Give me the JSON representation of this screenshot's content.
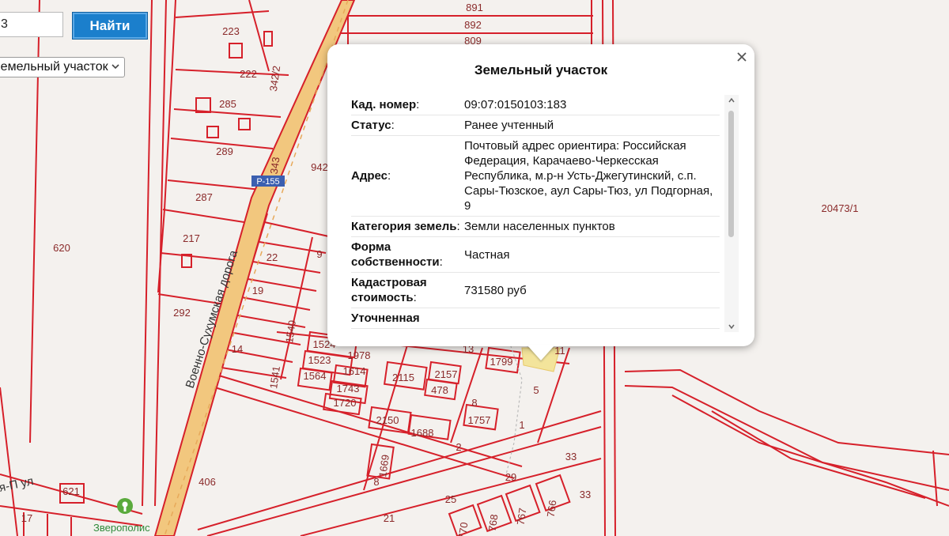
{
  "search": {
    "input_value": "3",
    "button_label": "Найти",
    "layer_select_value": "Земельный участок"
  },
  "popup": {
    "title": "Земельный участок",
    "rows": [
      {
        "key": "Кад. номер",
        "value": "09:07:0150103:183"
      },
      {
        "key": "Статус",
        "value": "Ранее учтенный"
      },
      {
        "key": "Адрес",
        "value": "Почтовый адрес ориентира: Российская Федерация, Карачаево-Черкесская Республика, м.р-н Усть-Джегутинский, с.п. Сары-Тюзское, аул Сары-Тюз, ул Подгорная, 9"
      },
      {
        "key": "Категория земель",
        "value": "Земли населенных пунктов"
      },
      {
        "key": "Форма собственности",
        "value": "Частная"
      },
      {
        "key": "Кадастровая стоимость",
        "value": "731580 руб"
      },
      {
        "key": "Уточненная",
        "value": ""
      }
    ]
  },
  "map": {
    "road_name": "Военно-Сухумская дорога",
    "road_shield": "Р-155",
    "street_label": "я-П ул",
    "poi_name": "Зверополис",
    "parcel_labels": [
      "891",
      "892",
      "809",
      "223",
      "222",
      "342/2",
      "285",
      "289",
      "343",
      "942",
      "287",
      "217",
      "620",
      "292",
      "22",
      "9",
      "19",
      "1540",
      "14",
      "1524",
      "1978",
      "1523",
      "1614",
      "1541",
      "1564",
      "1743",
      "2115",
      "2157",
      "478",
      "1720",
      "13",
      "1799",
      "11",
      "5",
      "8",
      "1757",
      "1",
      "2150",
      "1688",
      "2",
      "33",
      "1669",
      "29",
      "406",
      "621",
      "8",
      "25",
      "21",
      "17",
      "770",
      "768",
      "767",
      "766",
      "33",
      "20473/1"
    ]
  },
  "colors": {
    "parcel_line": "#d6202a",
    "road_fill": "#f2c77e",
    "button": "#1b7fcc",
    "highlight": "#f3e49b"
  }
}
